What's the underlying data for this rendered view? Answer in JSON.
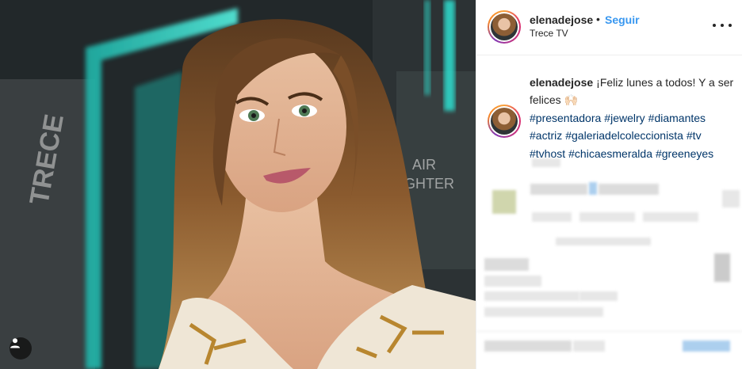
{
  "post": {
    "username": "elenadejose",
    "separator": "•",
    "follow_label": "Seguir",
    "location": "Trece TV",
    "caption_text": "¡Feliz lunes a todos! Y a ser felices 🙌🏻",
    "hashtags": [
      "#presentadora",
      "#jewelry",
      "#diamantes",
      "#actriz",
      "#galeriadelcoleccionista",
      "#tv",
      "#tvhost",
      "#chicaesmeralda",
      "#greeneyes"
    ]
  },
  "photo": {
    "background_sign_text": "TRECE",
    "background_sign_text2": "AIR",
    "background_sign_text3": "IGHTER",
    "user_tag_icon": "user-icon"
  },
  "icons": {
    "more": "more-options-icon",
    "tag": "user-icon"
  },
  "colors": {
    "accent": "#3897f0",
    "hashtag": "#003569",
    "teal": "#2fd6c8"
  }
}
